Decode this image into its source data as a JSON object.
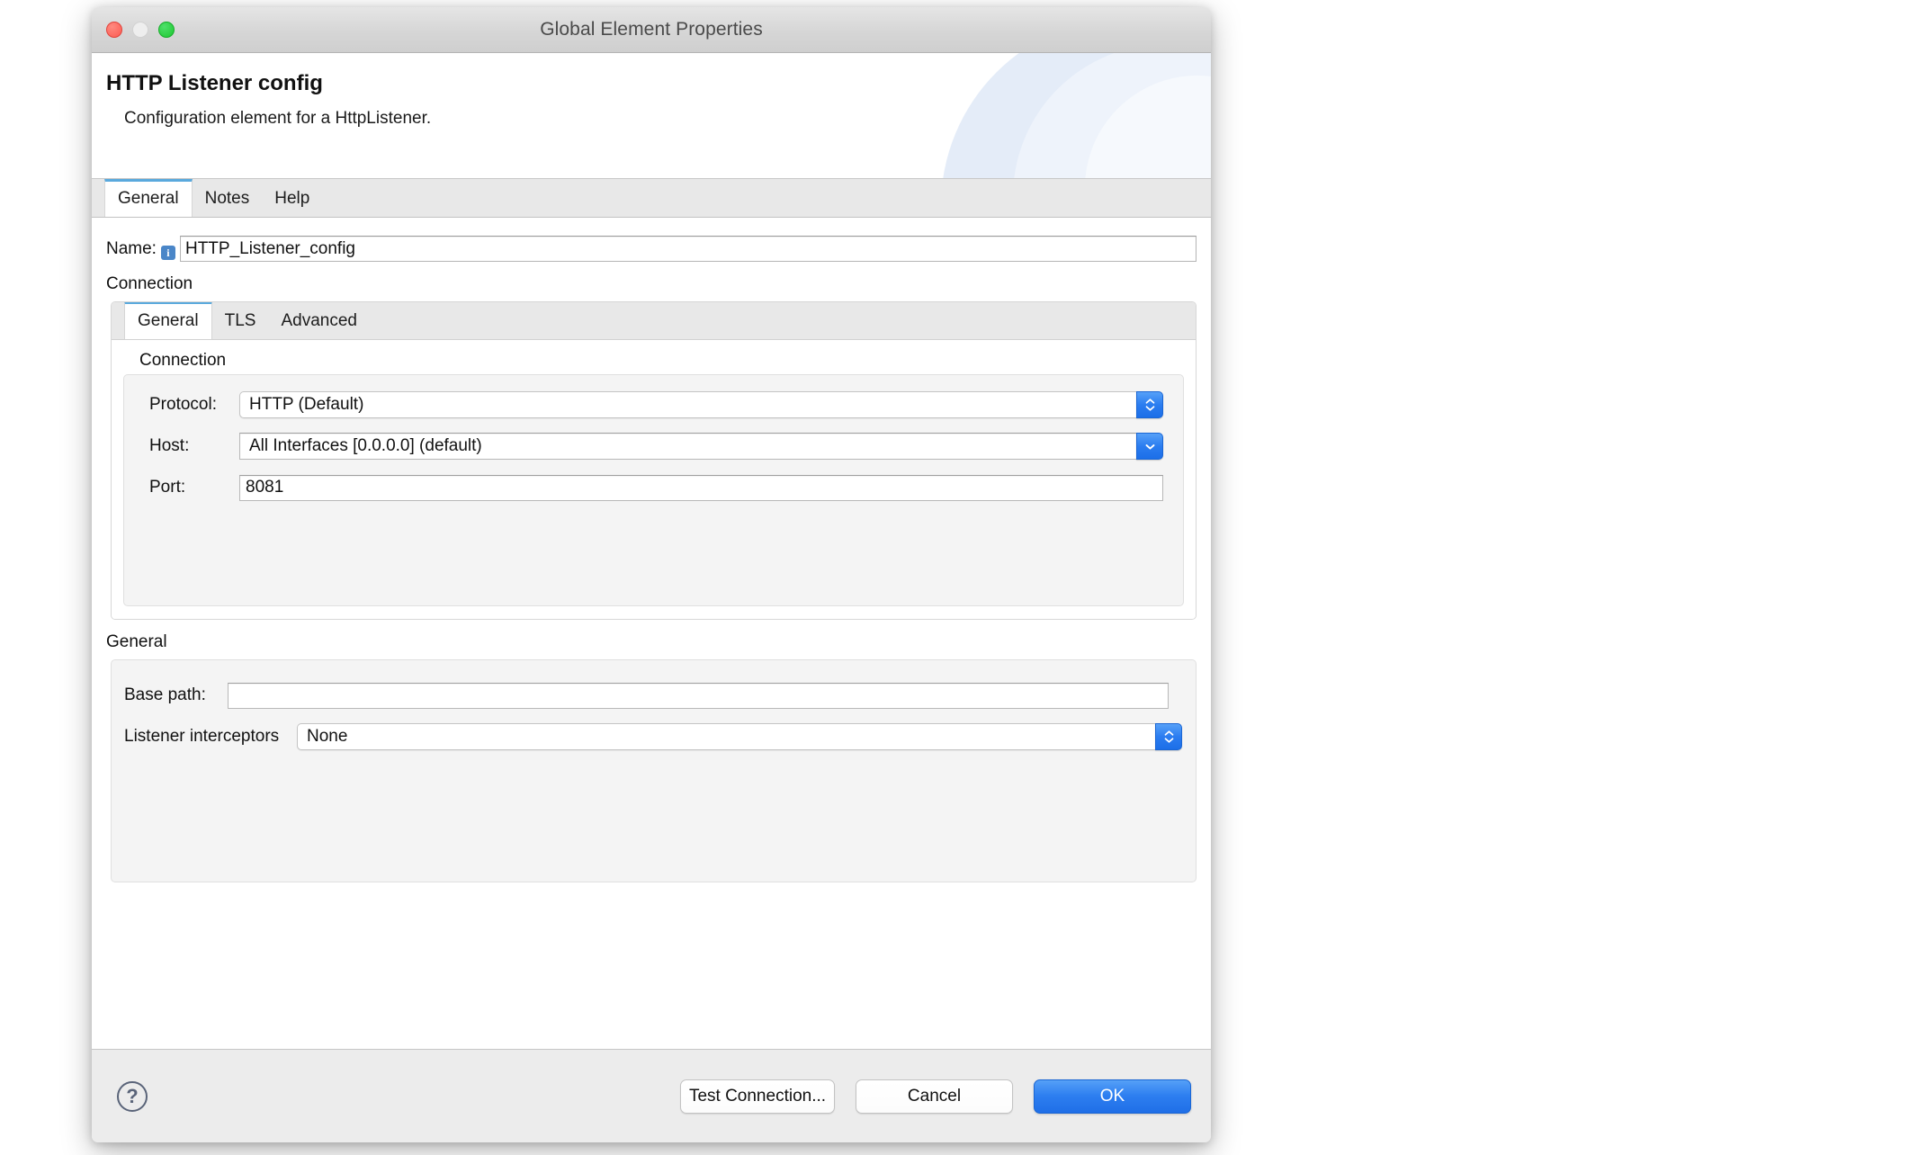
{
  "window": {
    "title": "Global Element Properties",
    "traffic_lights": [
      "close-button",
      "minimize-button",
      "zoom-button"
    ]
  },
  "header": {
    "title": "HTTP Listener config",
    "subtitle": "Configuration element for a HttpListener."
  },
  "outer_tabs": [
    {
      "label": "General",
      "active": true
    },
    {
      "label": "Notes",
      "active": false
    },
    {
      "label": "Help",
      "active": false
    }
  ],
  "name_field": {
    "label": "Name:",
    "info_glyph": "i",
    "value": "HTTP_Listener_config",
    "placeholder": ""
  },
  "connection_section": {
    "label": "Connection",
    "tabs": [
      {
        "label": "General",
        "active": true
      },
      {
        "label": "TLS",
        "active": false
      },
      {
        "label": "Advanced",
        "active": false
      }
    ],
    "group_title": "Connection",
    "rows": [
      {
        "label": "Protocol:",
        "type": "combo-stepper",
        "value": "HTTP (Default)",
        "icon": "chevron-up-down-icon"
      },
      {
        "label": "Host:",
        "type": "combo-flat",
        "value": "All Interfaces [0.0.0.0] (default)",
        "icon": "chevron-down-icon"
      },
      {
        "label": "Port:",
        "type": "text",
        "value": "8081",
        "placeholder": ""
      }
    ]
  },
  "general_section": {
    "label": "General",
    "rows": [
      {
        "label": "Base path:",
        "type": "text",
        "value": "",
        "placeholder": ""
      },
      {
        "label": "Listener interceptors",
        "type": "combo-stepper",
        "value": "None",
        "icon": "chevron-up-down-icon"
      }
    ]
  },
  "footer": {
    "help_glyph": "?",
    "buttons": [
      {
        "label": "Test Connection...",
        "style": "plain"
      },
      {
        "label": "Cancel",
        "style": "plain"
      },
      {
        "label": "OK",
        "style": "primary"
      }
    ]
  },
  "colors": {
    "accent_blue": "#2d7ef0",
    "tab_underline": "#5aa9dd",
    "info_badge": "#4a86c8",
    "window_chrome": "#ececec",
    "header_arc": "#e4ecf8"
  }
}
